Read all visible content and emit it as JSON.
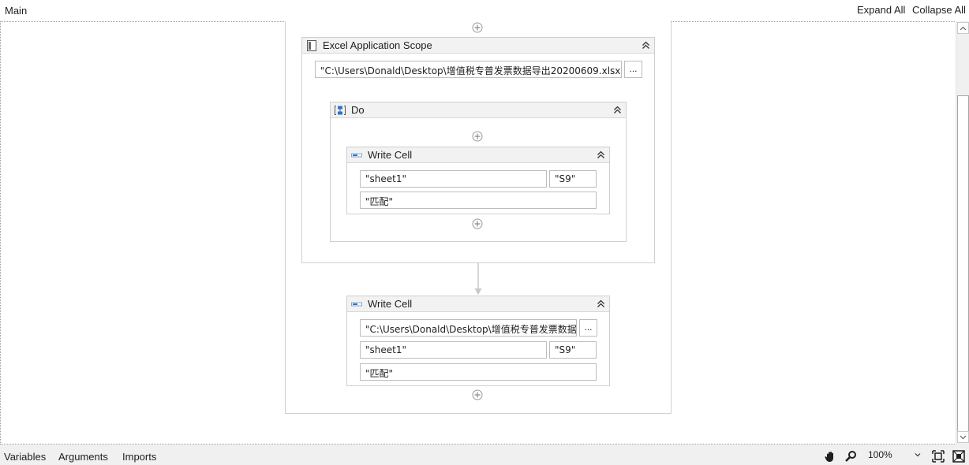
{
  "header": {
    "breadcrumb": "Main",
    "expand_all": "Expand All",
    "collapse_all": "Collapse All"
  },
  "excel_scope": {
    "title": "Excel Application Scope",
    "icon": "excel-scope-icon",
    "workbook_path": "\"C:\\Users\\Donald\\Desktop\\增值税专普发票数据导出20200609.xlsx\"",
    "browse_label": "..."
  },
  "do_sequence": {
    "title": "Do",
    "icon": "sequence-icon"
  },
  "write_cell_inner": {
    "title": "Write Cell",
    "icon": "write-cell-icon",
    "sheet": "\"sheet1\"",
    "range": "\"S9\"",
    "value": "\"匹配\""
  },
  "write_cell_outer": {
    "title": "Write Cell",
    "icon": "write-cell-icon",
    "workbook_path": "\"C:\\Users\\Donald\\Desktop\\增值税专普发票数据",
    "browse_label": "...",
    "sheet": "\"sheet1\"",
    "range": "\"S9\"",
    "value": "\"匹配\""
  },
  "statusbar": {
    "tabs": [
      "Variables",
      "Arguments",
      "Imports"
    ],
    "zoom": "100%",
    "icons": [
      "hand-pan-icon",
      "magnifier-icon",
      "fit-to-screen-icon",
      "overview-icon"
    ]
  }
}
